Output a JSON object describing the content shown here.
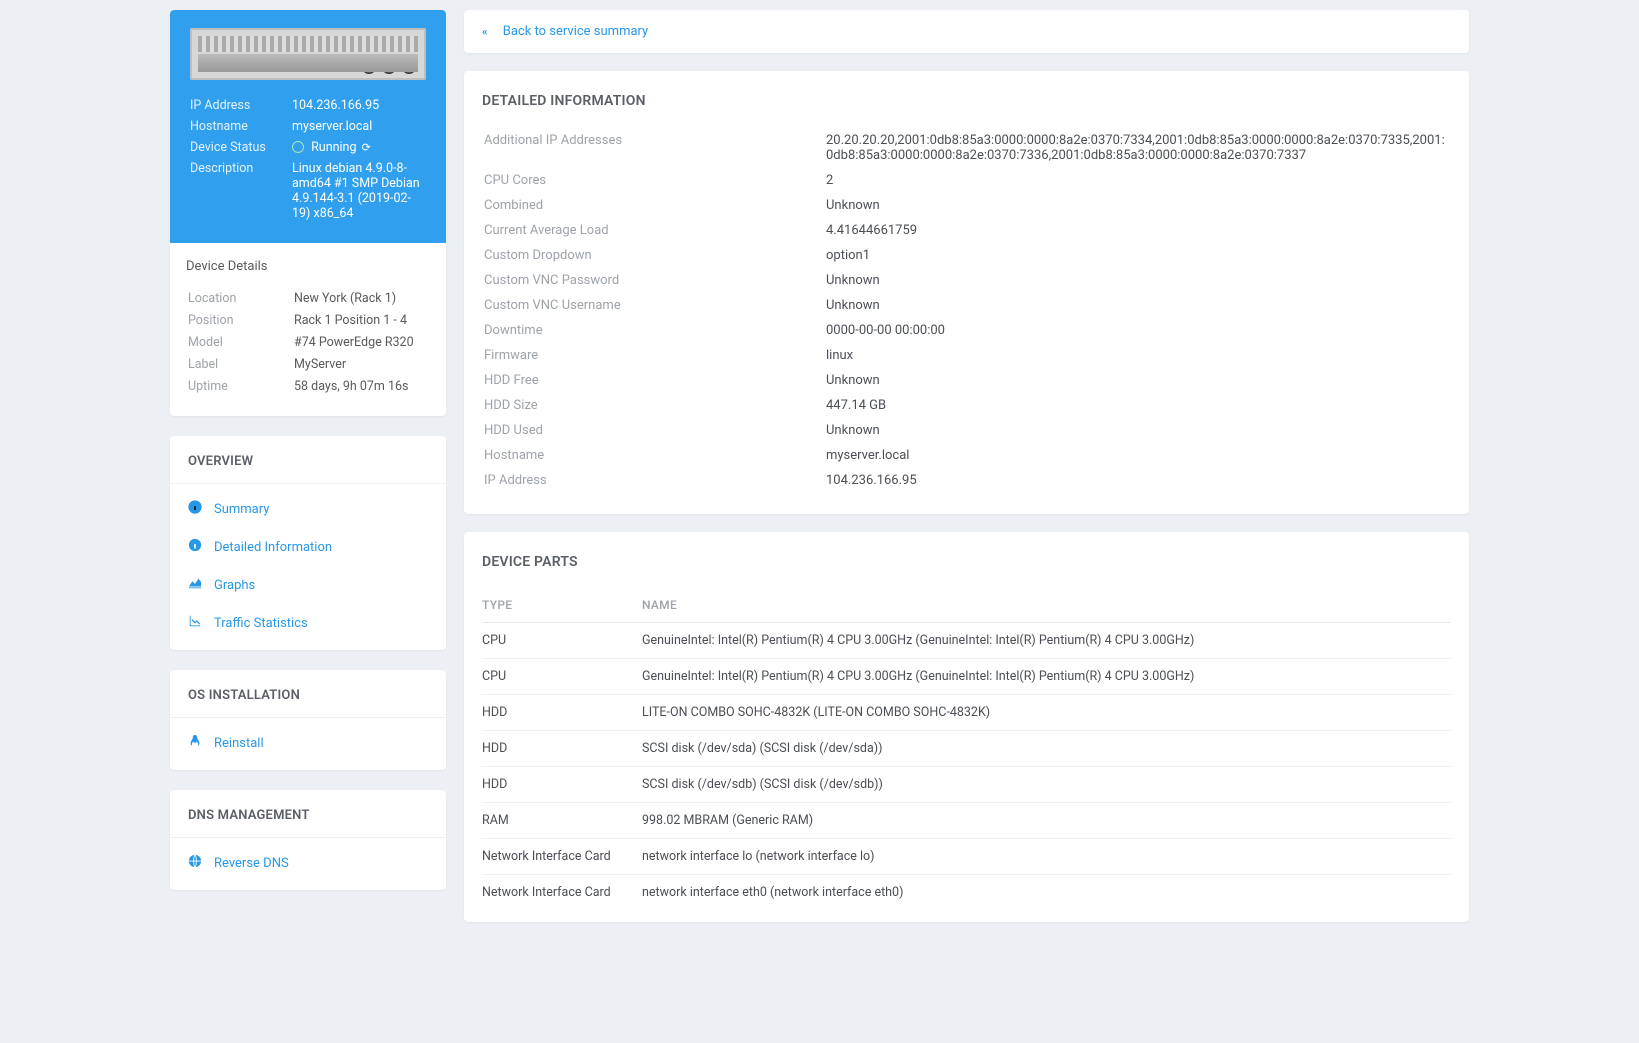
{
  "back_link": "Back to service summary",
  "hero": {
    "labels": {
      "ip": "IP Address",
      "host": "Hostname",
      "status": "Device Status",
      "desc": "Description"
    },
    "ip": "104.236.166.95",
    "host": "myserver.local",
    "status": "Running",
    "desc": "Linux debian 4.9.0-8-amd64 #1 SMP Debian 4.9.144-3.1 (2019-02-19) x86_64"
  },
  "device_details": {
    "title": "Device Details",
    "rows": [
      {
        "k": "Location",
        "v": "New York (Rack 1)"
      },
      {
        "k": "Position",
        "v": "Rack 1 Position 1 - 4"
      },
      {
        "k": "Model",
        "v": "#74 PowerEdge R320"
      },
      {
        "k": "Label",
        "v": "MyServer"
      },
      {
        "k": "Uptime",
        "v": "58 days, 9h 07m 16s"
      }
    ]
  },
  "overview": {
    "title": "OVERVIEW",
    "items": [
      {
        "k": "summary",
        "label": "Summary",
        "icon": "info"
      },
      {
        "k": "detailed",
        "label": "Detailed Information",
        "icon": "info-solid"
      },
      {
        "k": "graphs",
        "label": "Graphs",
        "icon": "area"
      },
      {
        "k": "traffic",
        "label": "Traffic Statistics",
        "icon": "chart"
      }
    ]
  },
  "os_install": {
    "title": "OS INSTALLATION",
    "items": [
      {
        "k": "reinstall",
        "label": "Reinstall",
        "icon": "linux"
      }
    ]
  },
  "dns": {
    "title": "DNS MANAGEMENT",
    "items": [
      {
        "k": "rdns",
        "label": "Reverse DNS",
        "icon": "globe"
      }
    ]
  },
  "detailed": {
    "title": "DETAILED INFORMATION",
    "rows": [
      {
        "k": "Additional IP Addresses",
        "v": "20.20.20.20,2001:0db8:85a3:0000:0000:8a2e:0370:7334,2001:0db8:85a3:0000:0000:8a2e:0370:7335,2001:0db8:85a3:0000:0000:8a2e:0370:7336,2001:0db8:85a3:0000:0000:8a2e:0370:7337"
      },
      {
        "k": "CPU Cores",
        "v": "2"
      },
      {
        "k": "Combined",
        "v": "Unknown"
      },
      {
        "k": "Current Average Load",
        "v": "4.41644661759"
      },
      {
        "k": "Custom Dropdown",
        "v": "option1"
      },
      {
        "k": "Custom VNC Password",
        "v": "Unknown"
      },
      {
        "k": "Custom VNC Username",
        "v": "Unknown"
      },
      {
        "k": "Downtime",
        "v": "0000-00-00 00:00:00"
      },
      {
        "k": "Firmware",
        "v": "linux"
      },
      {
        "k": "HDD Free",
        "v": "Unknown"
      },
      {
        "k": "HDD Size",
        "v": "447.14 GB"
      },
      {
        "k": "HDD Used",
        "v": "Unknown"
      },
      {
        "k": "Hostname",
        "v": "myserver.local"
      },
      {
        "k": "IP Address",
        "v": "104.236.166.95"
      }
    ]
  },
  "parts": {
    "title": "DEVICE PARTS",
    "head": {
      "type": "TYPE",
      "name": "NAME"
    },
    "rows": [
      {
        "type": "CPU",
        "name": "GenuineIntel: Intel(R) Pentium(R) 4 CPU 3.00GHz (GenuineIntel: Intel(R) Pentium(R) 4 CPU 3.00GHz)"
      },
      {
        "type": "CPU",
        "name": "GenuineIntel: Intel(R) Pentium(R) 4 CPU 3.00GHz (GenuineIntel: Intel(R) Pentium(R) 4 CPU 3.00GHz)"
      },
      {
        "type": "HDD",
        "name": "LITE-ON COMBO SOHC-4832K (LITE-ON COMBO SOHC-4832K)"
      },
      {
        "type": "HDD",
        "name": "SCSI disk (/dev/sda) (SCSI disk (/dev/sda))"
      },
      {
        "type": "HDD",
        "name": "SCSI disk (/dev/sdb) (SCSI disk (/dev/sdb))"
      },
      {
        "type": "RAM",
        "name": "998.02 MBRAM (Generic RAM)"
      },
      {
        "type": "Network Interface Card",
        "name": "network interface lo (network interface lo)"
      },
      {
        "type": "Network Interface Card",
        "name": "network interface eth0 (network interface eth0)"
      }
    ]
  }
}
